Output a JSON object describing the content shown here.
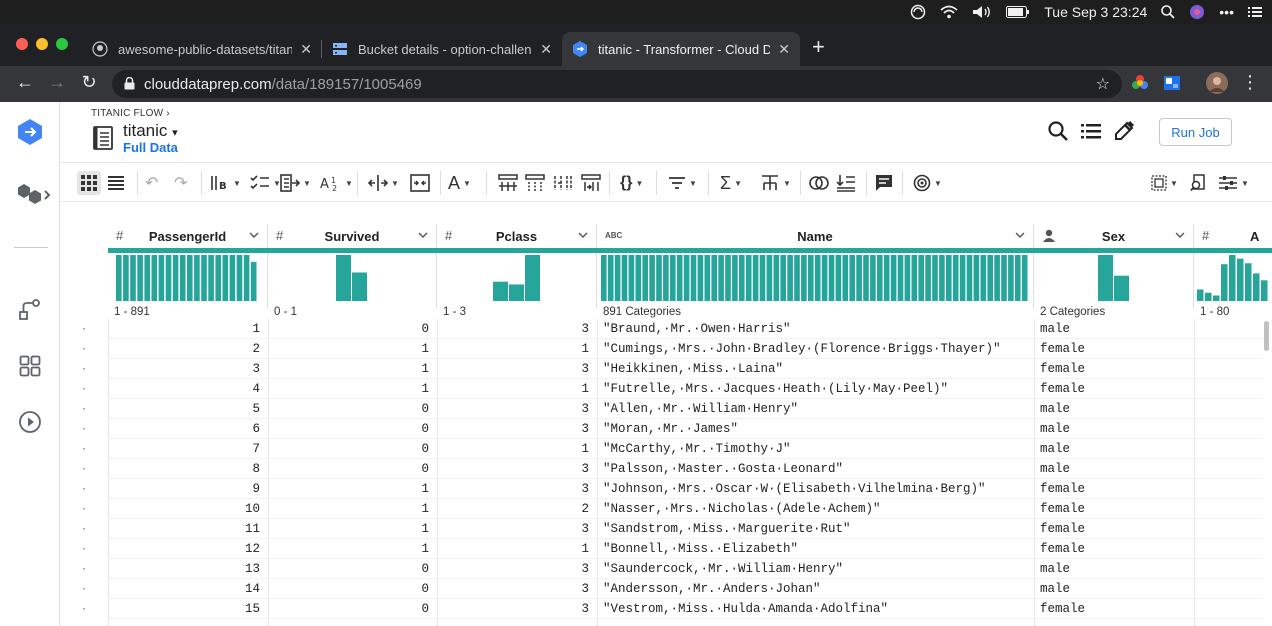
{
  "os_menubar": {
    "date_time": "Tue Sep 3  23:24"
  },
  "browser": {
    "tabs": [
      {
        "title": "awesome-public-datasets/titan",
        "active": false
      },
      {
        "title": "Bucket details - option-challen",
        "active": false
      },
      {
        "title": "titanic - Transformer - Cloud D",
        "active": true
      }
    ],
    "url_host": "clouddataprep.com",
    "url_path": "/data/189157/1005469"
  },
  "header": {
    "breadcrumb": "TITANIC FLOW  ›",
    "title": "titanic",
    "subtitle": "Full Data",
    "run_button": "Run Job"
  },
  "columns": [
    {
      "type": "#",
      "name": "PassengerId",
      "range": "1 - 891"
    },
    {
      "type": "#",
      "name": "Survived",
      "range": "0 - 1"
    },
    {
      "type": "#",
      "name": "Pclass",
      "range": "1 - 3"
    },
    {
      "type": "ABC",
      "name": "Name",
      "range": "891 Categories"
    },
    {
      "type": "person",
      "name": "Sex",
      "range": "2 Categories"
    },
    {
      "type": "#",
      "name": "A",
      "range": "1 - 80"
    }
  ],
  "colors": {
    "accent": "#26a69a",
    "link": "#1a73e8"
  },
  "rows": [
    {
      "id": "1",
      "survived": "0",
      "pclass": "3",
      "name": "\"Braund,·Mr.·Owen·Harris\"",
      "sex": "male"
    },
    {
      "id": "2",
      "survived": "1",
      "pclass": "1",
      "name": "\"Cumings,·Mrs.·John·Bradley·(Florence·Briggs·Thayer)\"",
      "sex": "female"
    },
    {
      "id": "3",
      "survived": "1",
      "pclass": "3",
      "name": "\"Heikkinen,·Miss.·Laina\"",
      "sex": "female"
    },
    {
      "id": "4",
      "survived": "1",
      "pclass": "1",
      "name": "\"Futrelle,·Mrs.·Jacques·Heath·(Lily·May·Peel)\"",
      "sex": "female"
    },
    {
      "id": "5",
      "survived": "0",
      "pclass": "3",
      "name": "\"Allen,·Mr.·William·Henry\"",
      "sex": "male"
    },
    {
      "id": "6",
      "survived": "0",
      "pclass": "3",
      "name": "\"Moran,·Mr.·James\"",
      "sex": "male"
    },
    {
      "id": "7",
      "survived": "0",
      "pclass": "1",
      "name": "\"McCarthy,·Mr.·Timothy·J\"",
      "sex": "male"
    },
    {
      "id": "8",
      "survived": "0",
      "pclass": "3",
      "name": "\"Palsson,·Master.·Gosta·Leonard\"",
      "sex": "male"
    },
    {
      "id": "9",
      "survived": "1",
      "pclass": "3",
      "name": "\"Johnson,·Mrs.·Oscar·W·(Elisabeth·Vilhelmina·Berg)\"",
      "sex": "female"
    },
    {
      "id": "10",
      "survived": "1",
      "pclass": "2",
      "name": "\"Nasser,·Mrs.·Nicholas·(Adele·Achem)\"",
      "sex": "female"
    },
    {
      "id": "11",
      "survived": "1",
      "pclass": "3",
      "name": "\"Sandstrom,·Miss.·Marguerite·Rut\"",
      "sex": "female"
    },
    {
      "id": "12",
      "survived": "1",
      "pclass": "1",
      "name": "\"Bonnell,·Miss.·Elizabeth\"",
      "sex": "female"
    },
    {
      "id": "13",
      "survived": "0",
      "pclass": "3",
      "name": "\"Saundercock,·Mr.·William·Henry\"",
      "sex": "male"
    },
    {
      "id": "14",
      "survived": "0",
      "pclass": "3",
      "name": "\"Andersson,·Mr.·Anders·Johan\"",
      "sex": "male"
    },
    {
      "id": "15",
      "survived": "0",
      "pclass": "3",
      "name": "\"Vestrom,·Miss.·Hulda·Amanda·Adolfina\"",
      "sex": "female"
    }
  ]
}
